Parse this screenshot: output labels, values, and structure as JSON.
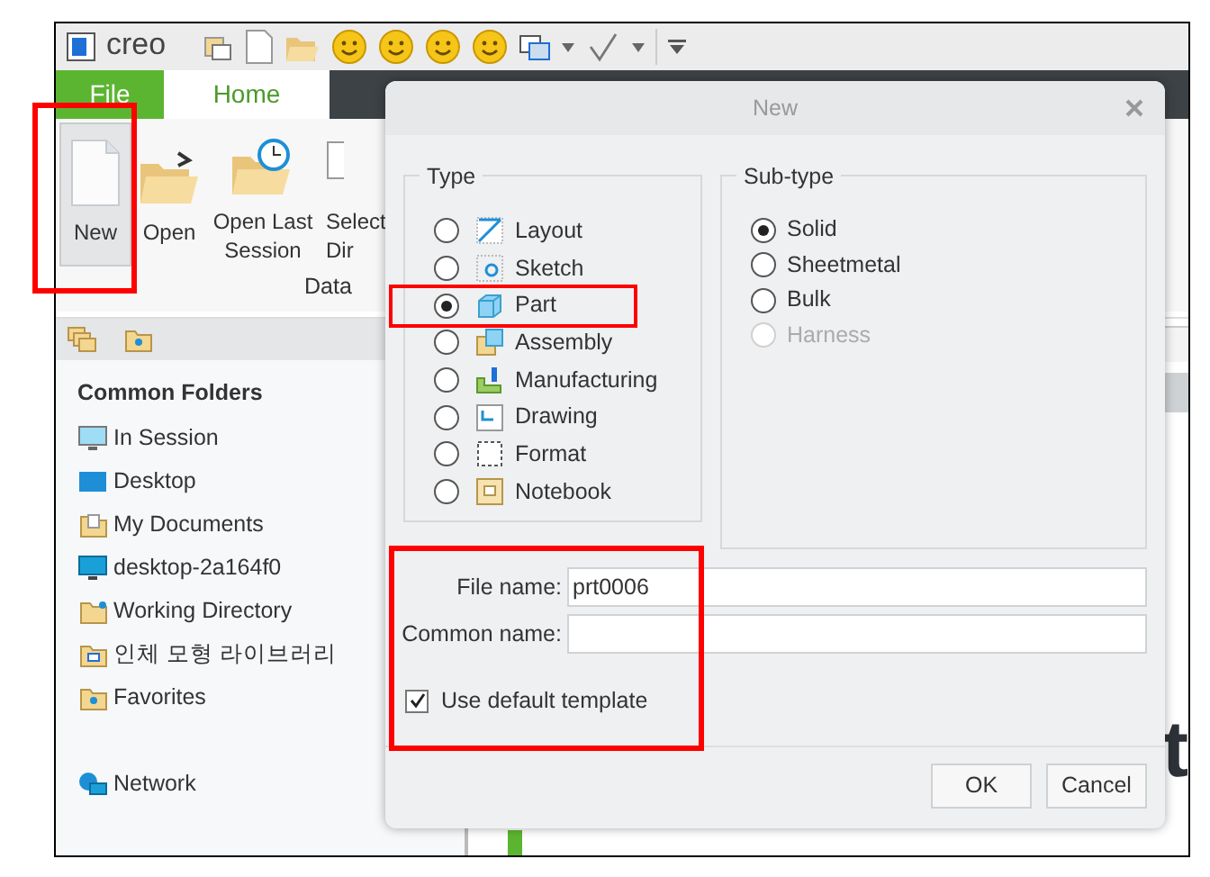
{
  "app": {
    "logo": "creo"
  },
  "ribbon_tabs": [
    {
      "label": "File",
      "selected": false,
      "kind": "file"
    },
    {
      "label": "Home",
      "selected": true,
      "kind": "tab"
    }
  ],
  "ribbon_buttons": [
    {
      "label": "New",
      "selected": true
    },
    {
      "label": "Open",
      "selected": false
    },
    {
      "label": "Open Last Session",
      "selected": false
    },
    {
      "label": "Select Dir",
      "selected": false
    }
  ],
  "ribbon_group": "Data",
  "navigator": {
    "heading": "Common Folders",
    "items": [
      {
        "label": "In Session"
      },
      {
        "label": "Desktop"
      },
      {
        "label": "My Documents"
      },
      {
        "label": "desktop-2a164f0"
      },
      {
        "label": "Working Directory"
      },
      {
        "label": "인체 모형 라이브러리"
      },
      {
        "label": "Favorites"
      }
    ],
    "network": "Network"
  },
  "background": {
    "heading_end": "t"
  },
  "dialog": {
    "title": "New",
    "type_group": {
      "title": "Type",
      "options": [
        {
          "label": "Layout",
          "selected": false
        },
        {
          "label": "Sketch",
          "selected": false
        },
        {
          "label": "Part",
          "selected": true
        },
        {
          "label": "Assembly",
          "selected": false
        },
        {
          "label": "Manufacturing",
          "selected": false
        },
        {
          "label": "Drawing",
          "selected": false
        },
        {
          "label": "Format",
          "selected": false
        },
        {
          "label": "Notebook",
          "selected": false
        }
      ]
    },
    "subtype_group": {
      "title": "Sub-type",
      "options": [
        {
          "label": "Solid",
          "selected": true,
          "disabled": false
        },
        {
          "label": "Sheetmetal",
          "selected": false,
          "disabled": false
        },
        {
          "label": "Bulk",
          "selected": false,
          "disabled": false
        },
        {
          "label": "Harness",
          "selected": false,
          "disabled": true
        }
      ]
    },
    "fields": [
      {
        "label": "File name:",
        "value": "prt0006"
      },
      {
        "label": "Common name:"
      }
    ],
    "template": {
      "label": "Use default template",
      "checked": true
    },
    "buttons": [
      "OK",
      "Cancel"
    ]
  }
}
